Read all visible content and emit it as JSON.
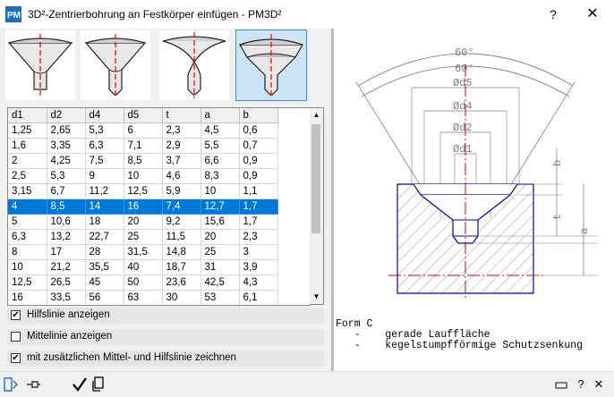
{
  "window": {
    "title": "3D²-Zentrierbohrung an Festkörper einfügen   -   PM3D²",
    "help": "?",
    "close": "✕"
  },
  "thumbnails": [
    {
      "name": "form-a",
      "selected": false
    },
    {
      "name": "form-b",
      "selected": false
    },
    {
      "name": "form-r",
      "selected": false
    },
    {
      "name": "form-c",
      "selected": true
    }
  ],
  "table": {
    "headers": [
      "d1",
      "d2",
      "d4",
      "d5",
      "t",
      "a",
      "b"
    ],
    "selected_row": 5,
    "rows": [
      [
        "1,25",
        "2,65",
        "5,3",
        "6",
        "2,3",
        "4,5",
        "0,6"
      ],
      [
        "1,6",
        "3,35",
        "6,3",
        "7,1",
        "2,9",
        "5,5",
        "0,7"
      ],
      [
        "2",
        "4,25",
        "7,5",
        "8,5",
        "3,7",
        "6,6",
        "0,9"
      ],
      [
        "2,5",
        "5,3",
        "9",
        "10",
        "4,6",
        "8,3",
        "0,9"
      ],
      [
        "3,15",
        "6,7",
        "11,2",
        "12,5",
        "5,9",
        "10",
        "1,1"
      ],
      [
        "4",
        "8,5",
        "14",
        "16",
        "7,4",
        "12,7",
        "1,7"
      ],
      [
        "5",
        "10,6",
        "18",
        "20",
        "9,2",
        "15,6",
        "1,7"
      ],
      [
        "6,3",
        "13,2",
        "22,7",
        "25",
        "11,5",
        "20",
        "2,3"
      ],
      [
        "8",
        "17",
        "28",
        "31,5",
        "14,8",
        "25",
        "3"
      ],
      [
        "10",
        "21,2",
        "35,5",
        "40",
        "18,7",
        "31",
        "3,9"
      ],
      [
        "12,5",
        "26,5",
        "45",
        "50",
        "23,6",
        "42,5",
        "4,3"
      ],
      [
        "16",
        "33,5",
        "56",
        "63",
        "30",
        "53",
        "6,1"
      ]
    ]
  },
  "options": [
    {
      "label": "Hilfslinie anzeigen",
      "checked": true
    },
    {
      "label": "Mittelinie anzeigen",
      "checked": false
    },
    {
      "label": "mit zusätzlichen Mittel- und Hilfslinie zeichnen",
      "checked": true
    }
  ],
  "drawing": {
    "angle1": "60°",
    "angle2": "60°",
    "d5": "Ød5",
    "d4": "Ød4",
    "d2": "Ød2",
    "d1": "Ød1",
    "b": "b",
    "t": "t",
    "a": "a",
    "colors": {
      "part": "#0000c8",
      "centerline": "#e00000",
      "dims": "#808080"
    }
  },
  "description": {
    "title": "Form C",
    "bullet1": "   -    gerade Lauffläche",
    "bullet2": "   -    kegelstumpfförmige Schutzsenkung"
  },
  "footer": {
    "collapse_icon": "panel-collapse-icon",
    "pin_icon": "pin-icon",
    "ok_icon": "checkmark-icon",
    "copy_icon": "copy-icon",
    "minimize_icon": "minimize-icon",
    "help_icon": "help-icon",
    "close_icon": "close-icon",
    "help": "?",
    "close": "✕"
  }
}
